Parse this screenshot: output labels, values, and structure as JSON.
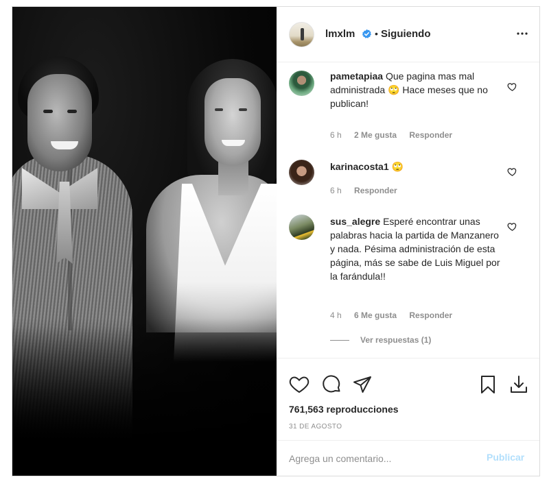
{
  "post": {
    "author": {
      "username": "lmxlm",
      "verified": true,
      "separator": "•",
      "follow_status": "Siguiendo"
    },
    "media": {
      "kind": "video",
      "description_icon": "photo"
    },
    "comments": [
      {
        "username": "pametapiaa",
        "text": "Que pagina mas mal administrada 🙄 Hace meses que no publican!",
        "time": "6 h",
        "likes": "2 Me gusta",
        "reply_label": "Responder"
      },
      {
        "username": "karinacosta1",
        "text": "🙄",
        "time": "6 h",
        "likes": "",
        "reply_label": "Responder"
      },
      {
        "username": "sus_alegre",
        "text": "Esperé encontrar unas palabras hacia la partida de Manzanero y nada. Pésima administración de esta página, más se sabe de Luis Miguel por la farándula!!",
        "time": "4 h",
        "likes": "6 Me gusta",
        "reply_label": "Responder",
        "view_replies": "Ver respuestas (1)"
      }
    ],
    "views": "761,563 reproducciones",
    "date": "31 DE AGOSTO",
    "compose": {
      "placeholder": "Agrega un comentario...",
      "publish_label": "Publicar"
    },
    "colors": {
      "verified": "#3897f0",
      "publish_disabled": "#b2dffc",
      "muted_text": "#8e8e8e"
    },
    "icons": {
      "more": "more-options-icon",
      "like": "heart-icon",
      "comment": "comment-icon",
      "share": "share-icon",
      "save": "bookmark-icon",
      "download": "download-icon"
    }
  }
}
